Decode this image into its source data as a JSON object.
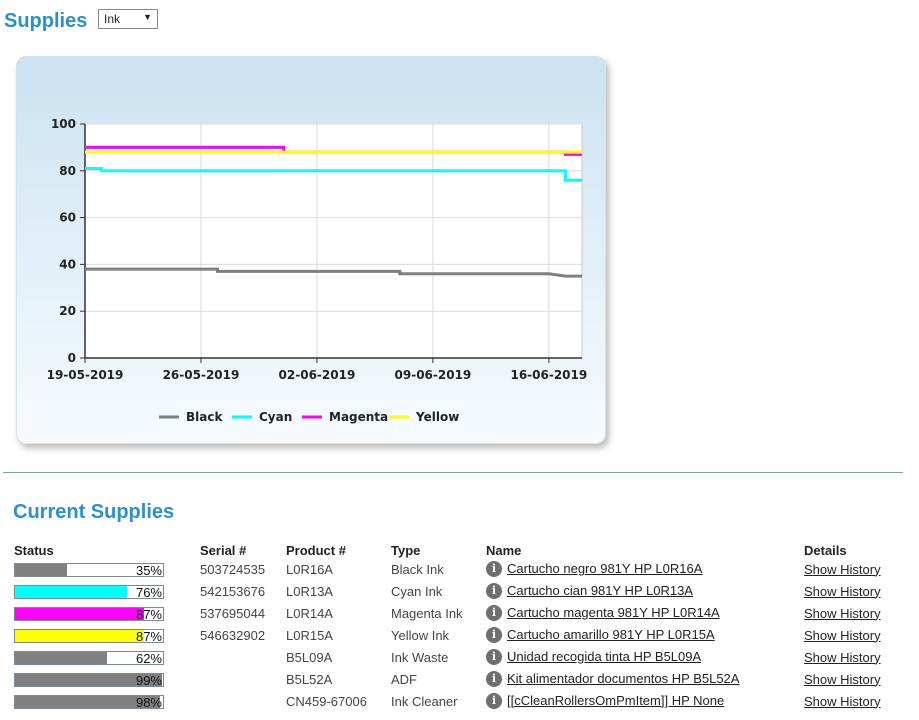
{
  "page": {
    "title": "Supplies",
    "dropdown": {
      "selected": "Ink"
    },
    "current_title": "Current Supplies"
  },
  "chart_data": {
    "type": "line",
    "x_ticks": [
      "19-05-2019",
      "26-05-2019",
      "02-06-2019",
      "09-06-2019",
      "16-06-2019"
    ],
    "x_range": [
      "19-05-2019",
      "18-06-2019"
    ],
    "y_ticks": [
      0,
      20,
      40,
      60,
      80,
      100
    ],
    "ylim": [
      0,
      100
    ],
    "grid": true,
    "legend_position": "bottom",
    "series": [
      {
        "name": "Black",
        "color": "#7f7f7f",
        "points": [
          [
            "19-05-2019",
            38
          ],
          [
            "27-05-2019",
            38
          ],
          [
            "27-05-2019",
            37
          ],
          [
            "07-06-2019",
            37
          ],
          [
            "07-06-2019",
            36
          ],
          [
            "16-06-2019",
            36
          ],
          [
            "17-06-2019",
            35
          ],
          [
            "18-06-2019",
            35
          ]
        ]
      },
      {
        "name": "Cyan",
        "color": "#00ffff",
        "points": [
          [
            "19-05-2019",
            81
          ],
          [
            "20-05-2019",
            81
          ],
          [
            "20-05-2019",
            80
          ],
          [
            "17-06-2019",
            80
          ],
          [
            "17-06-2019",
            76
          ],
          [
            "18-06-2019",
            76
          ]
        ]
      },
      {
        "name": "Magenta",
        "color": "#ff00ff",
        "points": [
          [
            "19-05-2019",
            90
          ],
          [
            "31-05-2019",
            90
          ],
          [
            "31-05-2019",
            88
          ],
          [
            "17-06-2019",
            88
          ],
          [
            "17-06-2019",
            87
          ],
          [
            "18-06-2019",
            87
          ]
        ]
      },
      {
        "name": "Yellow",
        "color": "#ffff00",
        "points": [
          [
            "19-05-2019",
            88
          ],
          [
            "09-06-2019",
            88
          ],
          [
            "17-06-2019",
            88
          ],
          [
            "18-06-2019",
            88
          ]
        ]
      }
    ]
  },
  "table": {
    "headers": {
      "status": "Status",
      "serial": "Serial #",
      "product": "Product #",
      "type": "Type",
      "name": "Name",
      "details": "Details"
    },
    "rows": [
      {
        "percent": "35%",
        "level": 0.35,
        "color": "#808080",
        "serial": "503724535",
        "product": "L0R16A",
        "type": "Black Ink",
        "name": "Cartucho negro 981Y HP L0R16A",
        "details": "Show History"
      },
      {
        "percent": "76%",
        "level": 0.76,
        "color": "#00ffff",
        "serial": "542153676",
        "product": "L0R13A",
        "type": "Cyan Ink",
        "name": "Cartucho cian 981Y HP L0R13A",
        "details": "Show History"
      },
      {
        "percent": "87%",
        "level": 0.87,
        "color": "#ff00ff",
        "serial": "537695044",
        "product": "L0R14A",
        "type": "Magenta Ink",
        "name": "Cartucho magenta 981Y HP L0R14A",
        "details": "Show History"
      },
      {
        "percent": "87%",
        "level": 0.87,
        "color": "#ffff00",
        "serial": "546632902",
        "product": "L0R15A",
        "type": "Yellow Ink",
        "name": "Cartucho amarillo 981Y HP L0R15A",
        "details": "Show History"
      },
      {
        "percent": "62%",
        "level": 0.62,
        "color": "#808080",
        "serial": "",
        "product": "B5L09A",
        "type": "Ink Waste",
        "name": "Unidad recogida tinta HP B5L09A",
        "details": "Show History"
      },
      {
        "percent": "99%",
        "level": 0.99,
        "color": "#808080",
        "serial": "",
        "product": "B5L52A",
        "type": "ADF",
        "name": "Kit alimentador documentos HP B5L52A",
        "details": "Show History"
      },
      {
        "percent": "98%",
        "level": 0.98,
        "color": "#808080",
        "serial": "",
        "product": "CN459-67006",
        "type": "Ink Cleaner",
        "name": "[[cCleanRollersOmPmItem]] HP None",
        "details": "Show History"
      }
    ]
  },
  "icons": {
    "info": "info-icon",
    "dropdown_arrow": "triangle-down-icon"
  }
}
